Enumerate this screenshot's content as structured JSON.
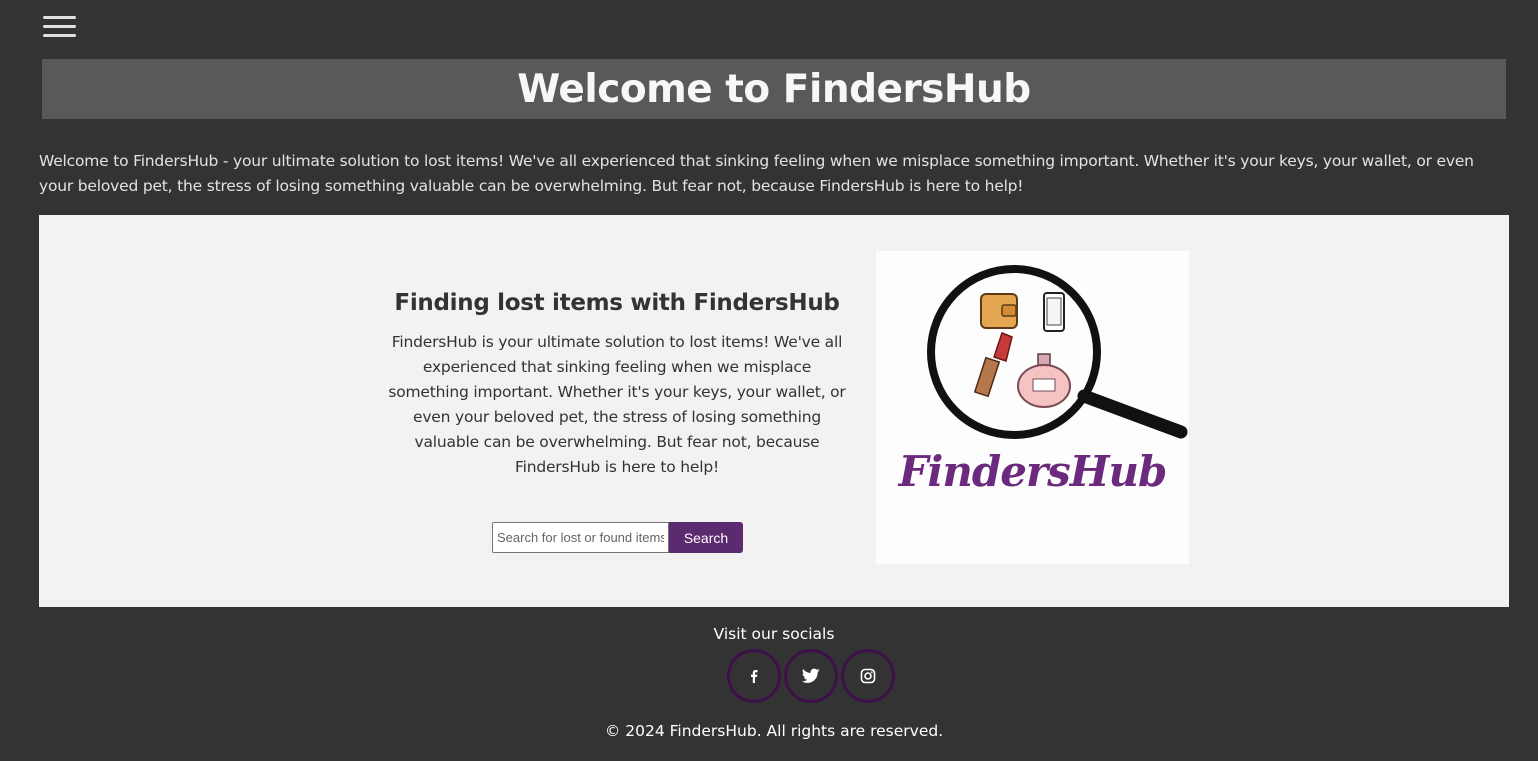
{
  "nav": {
    "menu_icon": "hamburger-menu-icon"
  },
  "hero": {
    "title": "Welcome to FindersHub"
  },
  "intro": {
    "text": "Welcome to FindersHub - your ultimate solution to lost items! We've all experienced that sinking feeling when we misplace something important. Whether it's your keys, your wallet, or even your beloved pet, the stress of losing something valuable can be overwhelming. But fear not, because FindersHub is here to help!"
  },
  "feature": {
    "heading": "Finding lost items with FindersHub",
    "body": "FindersHub is your ultimate solution to lost items! We've all experienced that sinking feeling when we misplace something important. Whether it's your keys, your wallet, or even your beloved pet, the stress of losing something valuable can be overwhelming. But fear not, because FindersHub is here to help!",
    "search": {
      "placeholder": "Search for lost or found items",
      "button_label": "Search"
    },
    "logo": {
      "wordmark": "FindersHub",
      "icon": "magnifying-glass-icon"
    }
  },
  "footer": {
    "socials_title": "Visit our socials",
    "socials": [
      {
        "name": "facebook",
        "icon": "facebook-icon"
      },
      {
        "name": "twitter",
        "icon": "twitter-icon"
      },
      {
        "name": "instagram",
        "icon": "instagram-icon"
      }
    ],
    "copyright": "© 2024 FindersHub. All rights are reserved."
  },
  "colors": {
    "background": "#333333",
    "hero_band": "#595959",
    "panel": "#f2f2f2",
    "accent": "#5c2a6e",
    "social_ring": "#3e1049"
  }
}
